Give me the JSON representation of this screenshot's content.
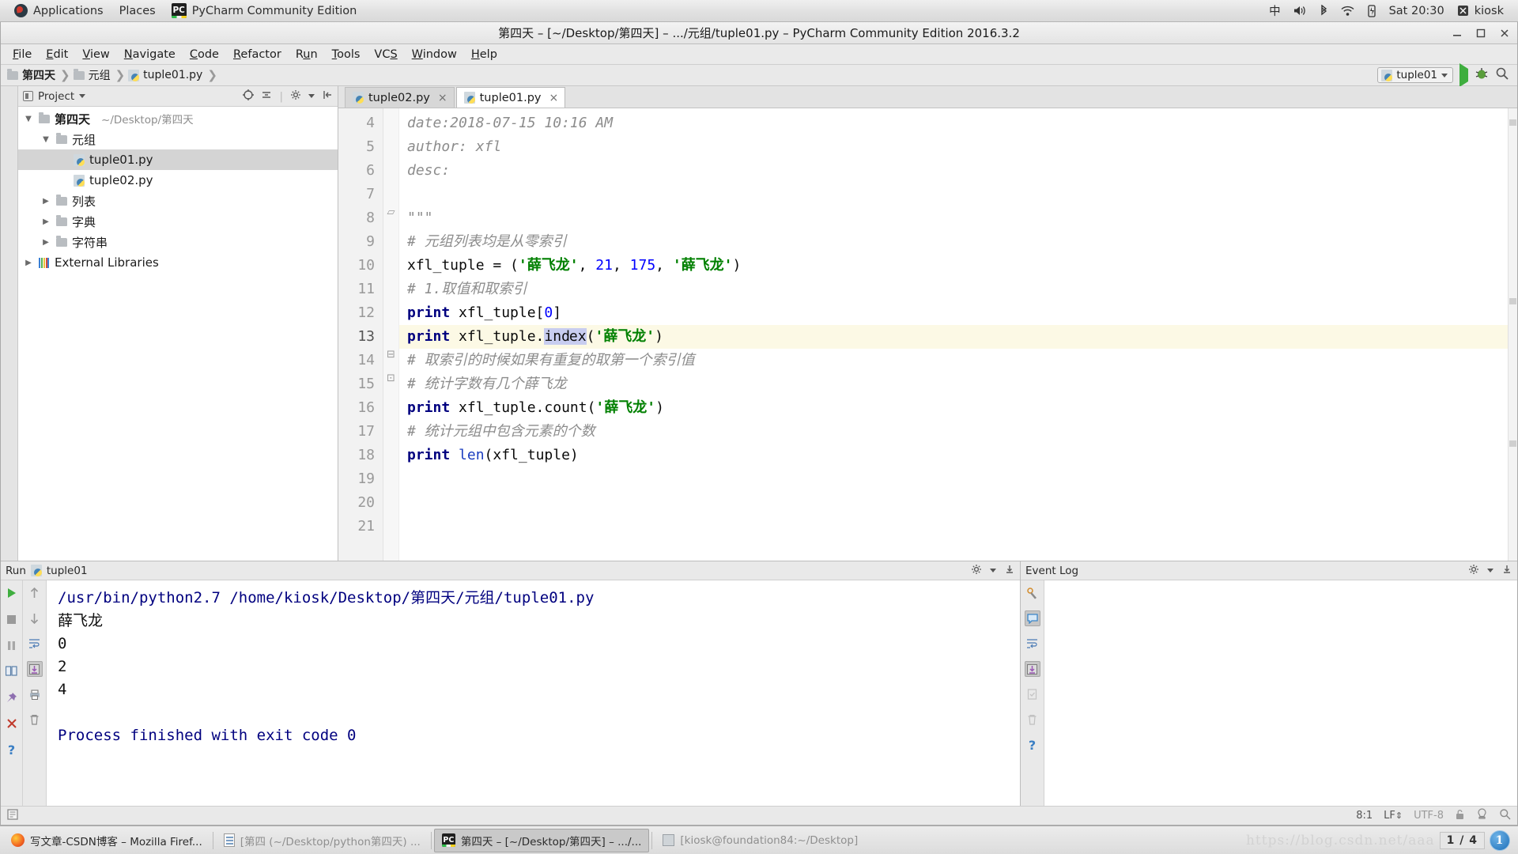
{
  "gnome_panel": {
    "left": [
      {
        "name": "applications-menu",
        "label": "Applications"
      },
      {
        "name": "places-menu",
        "label": "Places"
      },
      {
        "name": "active-app",
        "label": "PyCharm Community Edition"
      }
    ],
    "right": {
      "input_method": "中",
      "clock": "Sat 20:30",
      "user": "kiosk",
      "icons": [
        "volume-icon",
        "bluetooth-icon",
        "wifi-icon",
        "battery-icon"
      ]
    }
  },
  "window": {
    "title": "第四天 – [~/Desktop/第四天] – .../元组/tuple01.py – PyCharm Community Edition 2016.3.2",
    "buttons": [
      "minimize-button",
      "maximize-button",
      "close-button"
    ]
  },
  "menu": [
    "File",
    "Edit",
    "View",
    "Navigate",
    "Code",
    "Refactor",
    "Run",
    "Tools",
    "VCS",
    "Window",
    "Help"
  ],
  "navbar": {
    "breadcrumbs": [
      {
        "label": "第四天",
        "icon": "folder-icon",
        "bold": true
      },
      {
        "label": "元组",
        "icon": "folder-icon",
        "bold": false
      },
      {
        "label": "tuple01.py",
        "icon": "python-file-icon",
        "bold": false
      }
    ],
    "run_config": "tuple01",
    "actions": [
      "run-button",
      "debug-button",
      "search-everywhere-button"
    ]
  },
  "project_panel": {
    "title": "Project",
    "header_icons": [
      "target-icon",
      "collapse-all-icon",
      "gear-icon",
      "hide-icon"
    ],
    "tree": [
      {
        "indent": 0,
        "arrow": "▼",
        "icon": "folder-icon",
        "label": "第四天",
        "bold": true,
        "path": "~/Desktop/第四天",
        "selected": false
      },
      {
        "indent": 1,
        "arrow": "▼",
        "icon": "folder-icon",
        "label": "元组",
        "bold": false,
        "path": "",
        "selected": false
      },
      {
        "indent": 2,
        "arrow": "",
        "icon": "python-file-icon",
        "label": "tuple01.py",
        "bold": false,
        "path": "",
        "selected": true
      },
      {
        "indent": 2,
        "arrow": "",
        "icon": "python-file-icon",
        "label": "tuple02.py",
        "bold": false,
        "path": "",
        "selected": false
      },
      {
        "indent": 1,
        "arrow": "▶",
        "icon": "folder-icon",
        "label": "列表",
        "bold": false,
        "path": "",
        "selected": false
      },
      {
        "indent": 1,
        "arrow": "▶",
        "icon": "folder-icon",
        "label": "字典",
        "bold": false,
        "path": "",
        "selected": false
      },
      {
        "indent": 1,
        "arrow": "▶",
        "icon": "folder-icon",
        "label": "字符串",
        "bold": false,
        "path": "",
        "selected": false
      },
      {
        "indent": 0,
        "arrow": "▶",
        "icon": "libraries-icon",
        "label": "External Libraries",
        "bold": false,
        "path": "",
        "selected": false
      }
    ]
  },
  "editor": {
    "tabs": [
      {
        "label": "tuple02.py",
        "active": false
      },
      {
        "label": "tuple01.py",
        "active": true
      }
    ],
    "first_line_number": 4,
    "last_line_number": 21,
    "highlighted_line": 13,
    "lines": [
      {
        "n": 4,
        "text": "date:2018-07-15 10:16 AM"
      },
      {
        "n": 5,
        "text": "author: xfl"
      },
      {
        "n": 6,
        "text": "desc:"
      },
      {
        "n": 7,
        "text": ""
      },
      {
        "n": 8,
        "text": "\"\"\""
      },
      {
        "n": 9,
        "text": "# 元组列表均是从零索引"
      },
      {
        "n": 10,
        "text": "xfl_tuple = ('薛飞龙', 21, 175, '薛飞龙')"
      },
      {
        "n": 11,
        "text": "# 1.取值和取索引"
      },
      {
        "n": 12,
        "text": "print xfl_tuple[0]"
      },
      {
        "n": 13,
        "text": "print xfl_tuple.index('薛飞龙')"
      },
      {
        "n": 14,
        "text": "# 取索引的时候如果有重复的取第一个索引值"
      },
      {
        "n": 15,
        "text": "# 统计字数有几个薛飞龙"
      },
      {
        "n": 16,
        "text": "print xfl_tuple.count('薛飞龙')"
      },
      {
        "n": 17,
        "text": "# 统计元组中包含元素的个数"
      },
      {
        "n": 18,
        "text": "print len(xfl_tuple)"
      },
      {
        "n": 19,
        "text": ""
      },
      {
        "n": 20,
        "text": ""
      },
      {
        "n": 21,
        "text": ""
      }
    ]
  },
  "run_panel": {
    "title": "Run",
    "config_name": "tuple01",
    "left_icons": [
      "rerun-icon",
      "stop-icon",
      "pause-icon",
      "layout-icon",
      "pin-icon",
      "close-icon",
      "help-icon"
    ],
    "second_icons": [
      "scroll-up-icon",
      "scroll-down-icon",
      "soft-wrap-icon",
      "scroll-to-end-icon",
      "print-icon",
      "clear-all-icon"
    ],
    "header_icons": [
      "gear-icon",
      "hide-icon"
    ],
    "console": [
      {
        "text": "/usr/bin/python2.7 /home/kiosk/Desktop/第四天/元组/tuple01.py",
        "style": "blue"
      },
      {
        "text": "薛飞龙",
        "style": "plain"
      },
      {
        "text": "0",
        "style": "plain"
      },
      {
        "text": "2",
        "style": "plain"
      },
      {
        "text": "4",
        "style": "plain"
      },
      {
        "text": "",
        "style": "plain"
      },
      {
        "text": "Process finished with exit code 0",
        "style": "blue"
      }
    ]
  },
  "event_log": {
    "title": "Event Log",
    "header_icons": [
      "gear-icon",
      "hide-icon"
    ],
    "strip_icons": [
      "settings-icon",
      "balloon-icon",
      "soft-wrap-icon",
      "scroll-to-end-icon",
      "mark-read-icon",
      "clear-all-icon",
      "help-icon"
    ],
    "content": ""
  },
  "status_bar": {
    "caret_position": "8:1",
    "line_separator": "LF",
    "encoding": "UTF-8",
    "icons": [
      "lock-icon",
      "inspection-icon",
      "search-icon"
    ]
  },
  "taskbar": {
    "tasks": [
      {
        "icon": "firefox-icon",
        "label": "写文章-CSDN博客 – Mozilla Firef...",
        "active": false,
        "dim": false
      },
      {
        "icon": "document-icon",
        "label": "[第四 (~/Desktop/python第四天) ...",
        "active": false,
        "dim": true
      },
      {
        "icon": "pycharm-icon",
        "label": "第四天 – [~/Desktop/第四天] – .../...",
        "active": true,
        "dim": false
      },
      {
        "icon": "terminal-icon",
        "label": "[kiosk@foundation84:~/Desktop]",
        "active": false,
        "dim": true
      }
    ],
    "watermark": "https://blog.csdn.net/aaa",
    "page_indicator": "1 / 4",
    "workspace_badge": "1"
  }
}
